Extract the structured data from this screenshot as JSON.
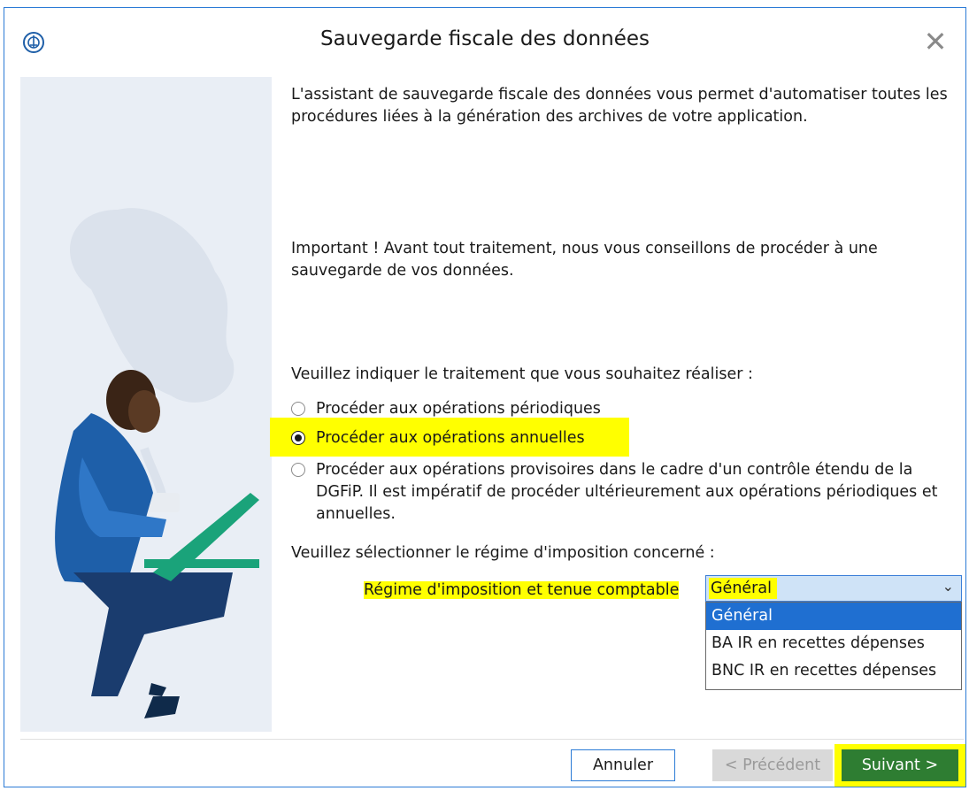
{
  "window": {
    "title": "Sauvegarde fiscale des données",
    "close_label": "✕"
  },
  "content": {
    "intro": "L'assistant de sauvegarde fiscale des données vous permet d'automatiser toutes les procédures liées à la génération des archives de votre application.",
    "important": "Important ! Avant tout traitement, nous vous conseillons de procéder à une sauvegarde de vos données.",
    "treatment_prompt": "Veuillez indiquer le traitement que vous souhaitez réaliser :",
    "options": [
      {
        "label": "Procéder aux opérations périodiques",
        "checked": false
      },
      {
        "label": "Procéder aux opérations annuelles",
        "checked": true
      },
      {
        "label": "Procéder aux opérations provisoires dans le cadre d'un contrôle étendu de la DGFiP. Il est impératif de procéder ultérieurement aux opérations périodiques et annuelles.",
        "checked": false
      }
    ],
    "regime_prompt": "Veuillez sélectionner le régime d'imposition concerné :",
    "regime_label": "Régime d'imposition et tenue comptable",
    "regime_value": "Général",
    "regime_options": [
      "Général",
      "BA IR en recettes dépenses",
      "BNC IR en recettes dépenses"
    ]
  },
  "buttons": {
    "cancel": "Annuler",
    "previous": "< Précédent",
    "next": "Suivant >"
  },
  "colors": {
    "accent": "#2b7bd6",
    "highlight": "#ffff00",
    "next_button": "#2e7d32",
    "selected_option": "#1f6fd1"
  },
  "icons": {
    "app": "app-logo-icon",
    "close": "close-icon",
    "dropdown": "chevron-down-icon"
  }
}
